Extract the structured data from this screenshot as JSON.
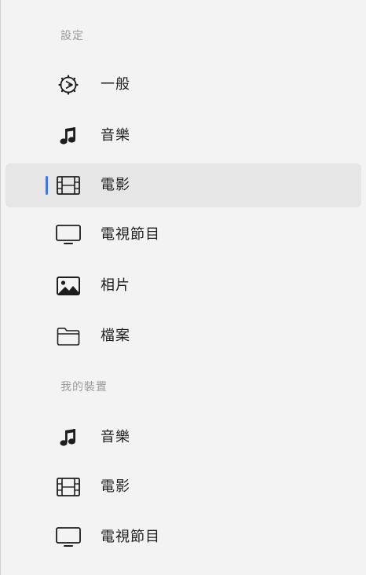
{
  "settings_section": {
    "header": "設定",
    "items": [
      {
        "label": "一般",
        "icon": "gear-icon"
      },
      {
        "label": "音樂",
        "icon": "music-note-icon"
      },
      {
        "label": "電影",
        "icon": "film-icon",
        "selected": true
      },
      {
        "label": "電視節目",
        "icon": "tv-icon"
      },
      {
        "label": "相片",
        "icon": "photo-icon"
      },
      {
        "label": "檔案",
        "icon": "folder-icon"
      }
    ]
  },
  "devices_section": {
    "header": "我的裝置",
    "items": [
      {
        "label": "音樂",
        "icon": "music-note-icon"
      },
      {
        "label": "電影",
        "icon": "film-icon"
      },
      {
        "label": "電視節目",
        "icon": "tv-icon"
      }
    ]
  },
  "colors": {
    "accent": "#3478f6",
    "selected_background": "#e6e6e6",
    "sidebar_background": "#f3f3f3"
  }
}
